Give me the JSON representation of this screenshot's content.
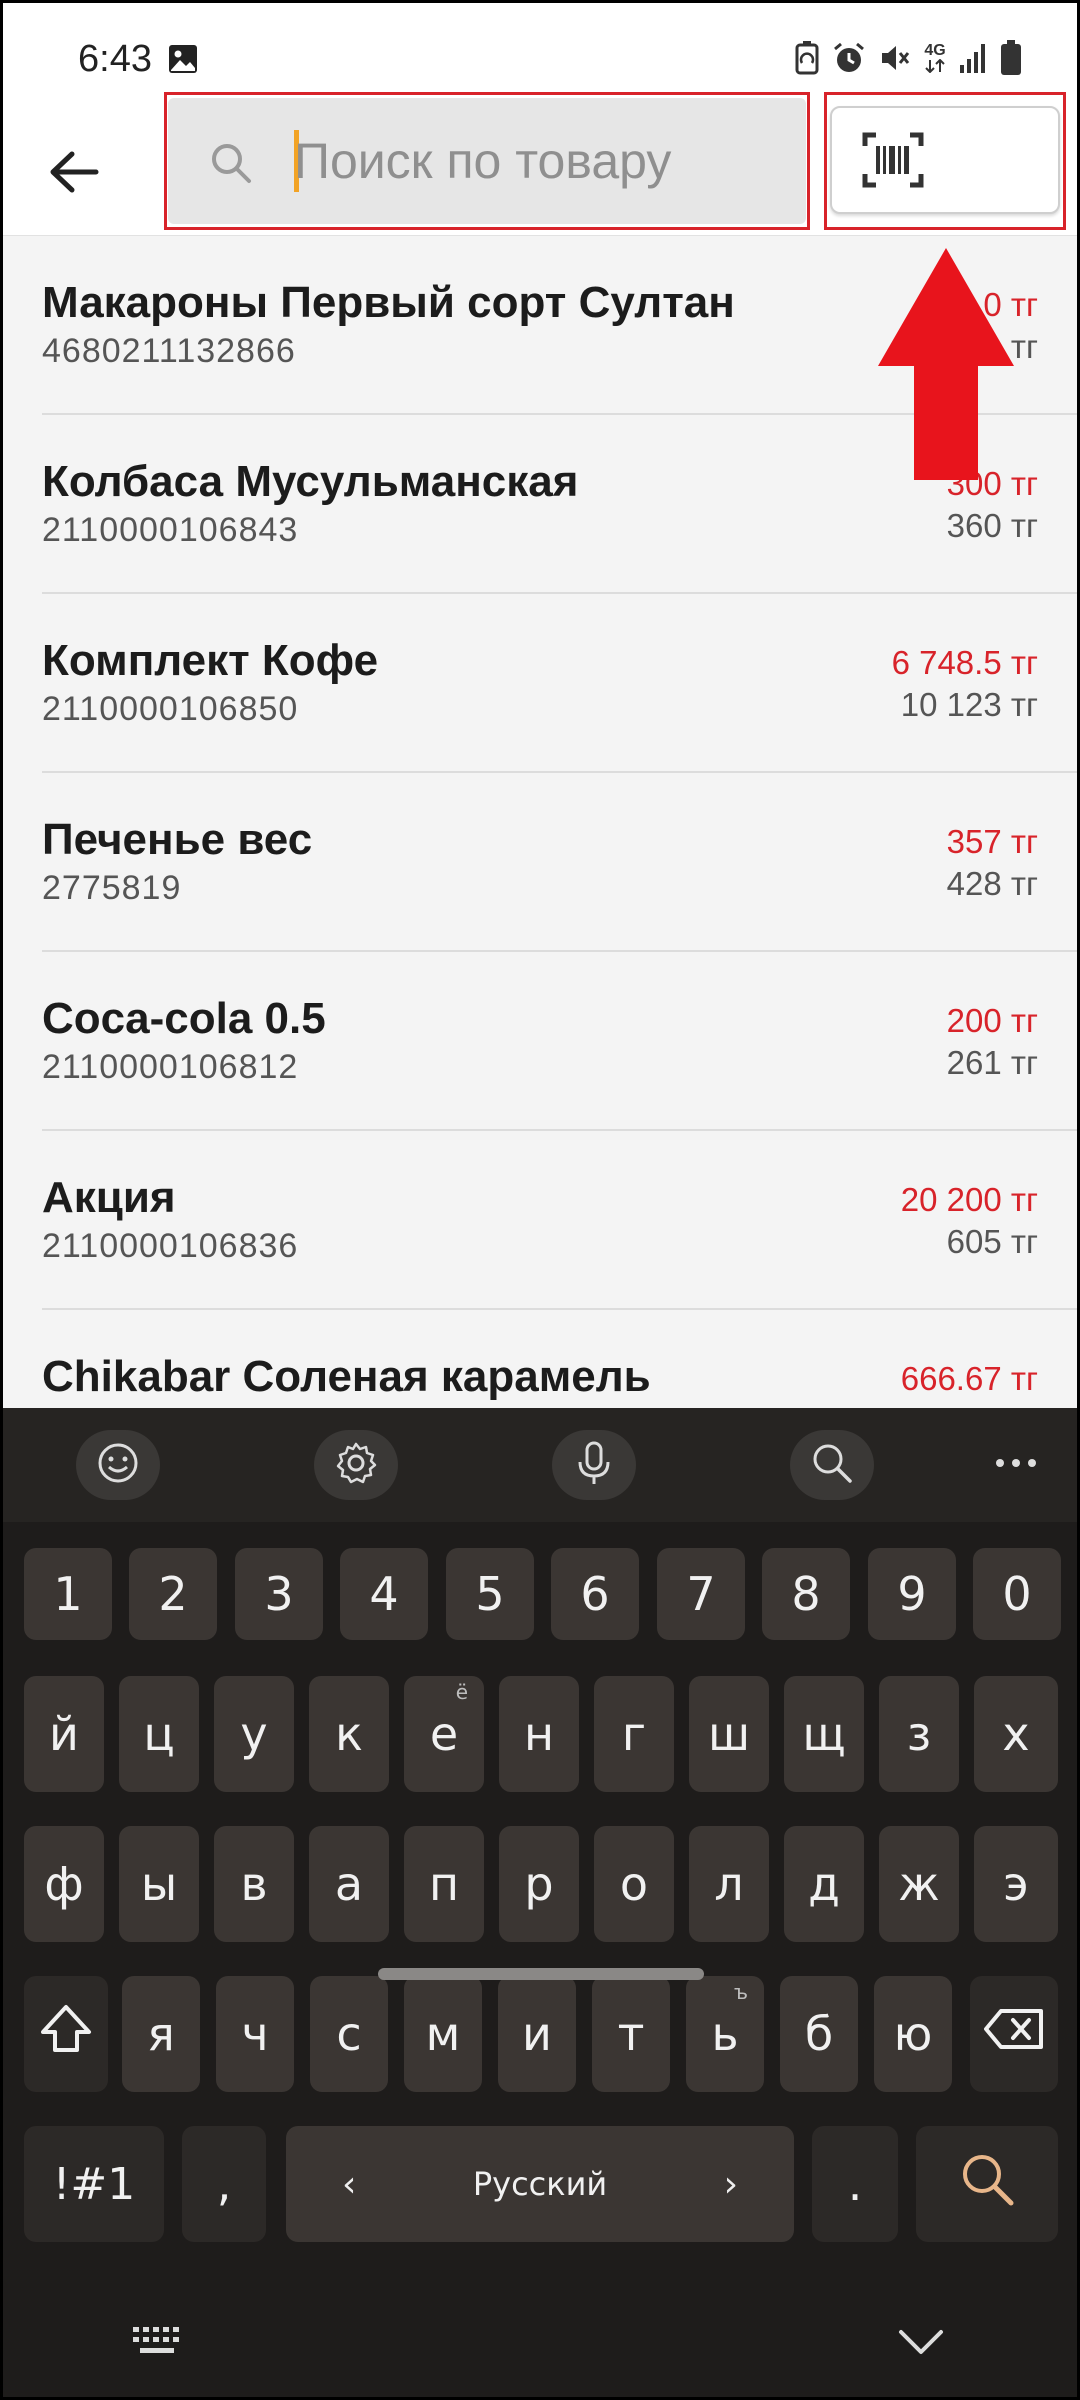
{
  "status_bar": {
    "time": "6:43",
    "network_label": "4G",
    "icons": [
      "image-icon",
      "battery-saver-icon",
      "alarm-icon",
      "mute-icon",
      "signal-icon",
      "battery-icon"
    ]
  },
  "header": {
    "back_icon": "arrow-left-icon",
    "search_placeholder": "Поиск по товару",
    "search_value": "",
    "barcode_icon": "barcode-scan-icon"
  },
  "annotation": {
    "color": "#e8141c"
  },
  "products": [
    {
      "name": "Макароны Первый сорт Султан",
      "code": "4680211132866",
      "sale_price": "0 тг",
      "regular_price": "тг"
    },
    {
      "name": "Колбаса Мусульманская",
      "code": "2110000106843",
      "sale_price": "300 тг",
      "regular_price": "360 тг"
    },
    {
      "name": "Комплект Кофе",
      "code": "2110000106850",
      "sale_price": "6 748.5 тг",
      "regular_price": "10 123 тг"
    },
    {
      "name": "Печенье вес",
      "code": "2775819",
      "sale_price": "357 тг",
      "regular_price": "428 тг"
    },
    {
      "name": "Coca-cola 0.5",
      "code": "2110000106812",
      "sale_price": "200 тг",
      "regular_price": "261 тг"
    },
    {
      "name": "Акция",
      "code": "2110000106836",
      "sale_price": "20 200 тг",
      "regular_price": "605 тг"
    },
    {
      "name": "Chikabar Соленая карамель",
      "code": "",
      "sale_price": "666.67 тг",
      "regular_price": ""
    }
  ],
  "colors": {
    "accent_red": "#d8232a",
    "keyboard_bg": "#1e1c1b",
    "key_bg": "#3b3633",
    "caret": "#f2a325"
  },
  "keyboard": {
    "toolbar": [
      "emoji-icon",
      "settings-icon",
      "microphone-icon",
      "search-icon",
      "more-icon"
    ],
    "number_row": [
      "1",
      "2",
      "3",
      "4",
      "5",
      "6",
      "7",
      "8",
      "9",
      "0"
    ],
    "row1": [
      "й",
      "ц",
      "у",
      "к",
      "е",
      "н",
      "г",
      "ш",
      "щ",
      "з",
      "х"
    ],
    "row1_alt": {
      "е": "ё"
    },
    "row2": [
      "ф",
      "ы",
      "в",
      "а",
      "п",
      "р",
      "о",
      "л",
      "д",
      "ж",
      "э"
    ],
    "row3": [
      "я",
      "ч",
      "с",
      "м",
      "и",
      "т",
      "ь",
      "б",
      "ю"
    ],
    "row3_alt": {
      "ь": "ъ"
    },
    "symbols_key": "!#1",
    "comma_key": ",",
    "space_label": "Русский",
    "space_left": "‹",
    "space_right": "›",
    "period_key": "."
  }
}
